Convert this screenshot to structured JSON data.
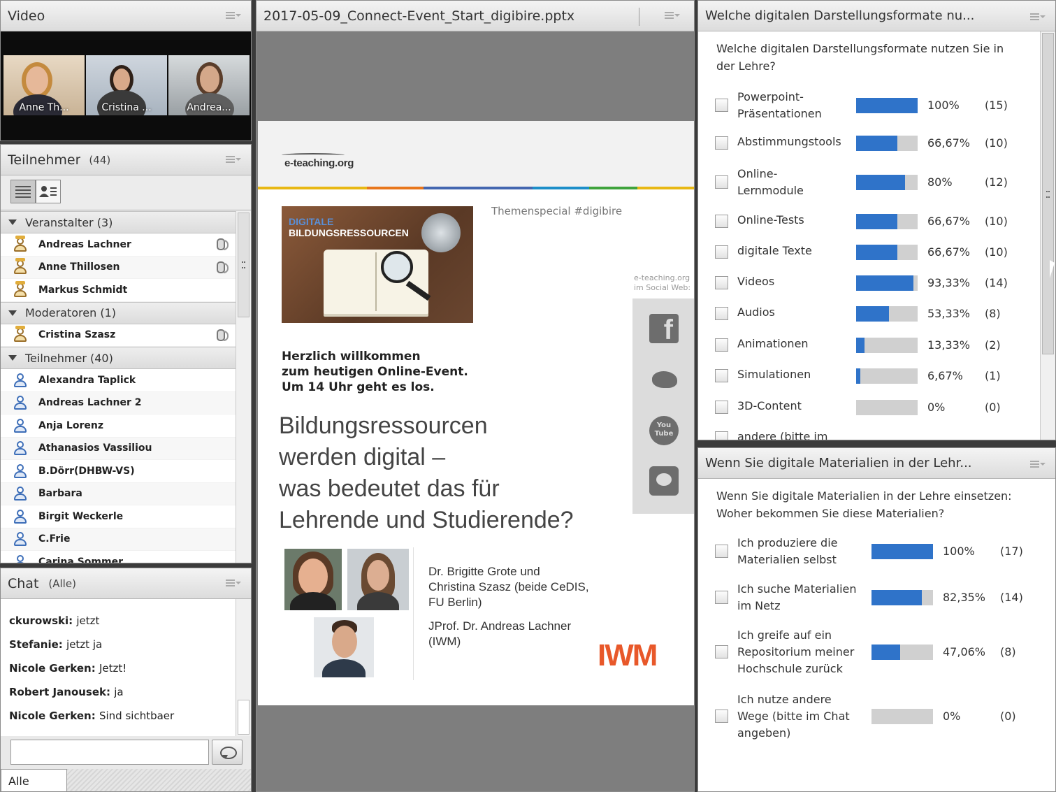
{
  "video": {
    "title": "Video",
    "tiles": [
      {
        "name": "Anne Th..."
      },
      {
        "name": "Cristina ..."
      },
      {
        "name": "Andrea..."
      }
    ]
  },
  "attendees": {
    "title": "Teilnehmer",
    "count": "(44)",
    "groups": [
      {
        "label": "Veranstalter (3)",
        "people": [
          {
            "name": "Andreas Lachner",
            "role": "host",
            "mic": true
          },
          {
            "name": "Anne Thillosen",
            "role": "host",
            "mic": true
          },
          {
            "name": "Markus Schmidt",
            "role": "host",
            "mic": false
          }
        ]
      },
      {
        "label": "Moderatoren (1)",
        "people": [
          {
            "name": "Cristina Szasz",
            "role": "host",
            "mic": true
          }
        ]
      },
      {
        "label": "Teilnehmer (40)",
        "people": [
          {
            "name": "Alexandra Taplick"
          },
          {
            "name": "Andreas Lachner 2"
          },
          {
            "name": "Anja Lorenz"
          },
          {
            "name": "Athanasios Vassiliou"
          },
          {
            "name": "B.Dörr(DHBW-VS)"
          },
          {
            "name": "Barbara"
          },
          {
            "name": "Birgit Weckerle"
          },
          {
            "name": "C.Frie"
          },
          {
            "name": "Carina Sommer"
          }
        ]
      }
    ]
  },
  "chat": {
    "title": "Chat",
    "scope": "(Alle)",
    "messages": [
      {
        "user": "ckurowski",
        "text": "jetzt"
      },
      {
        "user": "Stefanie",
        "text": "jetzt ja"
      },
      {
        "user": "Nicole Gerken",
        "text": "Jetzt!"
      },
      {
        "user": "Robert Janousek",
        "text": "ja"
      },
      {
        "user": "Nicole Gerken",
        "text": "Sind sichtbaer"
      }
    ],
    "input_value": "",
    "tab_label": "Alle"
  },
  "share": {
    "title": "2017-05-09_Connect-Event_Start_digibire.pptx",
    "slide": {
      "logo": "e-teaching.org",
      "thumb_line1": "DIGITALE",
      "thumb_line2": "BILDUNGSRESSOURCEN",
      "themen": "Themenspecial #digibire",
      "social_label_1": "e-teaching.org",
      "social_label_2": "im Social Web:",
      "welcome_1": "Herzlich willkommen",
      "welcome_2": "zum heutigen Online-Event.",
      "welcome_3": "Um 14 Uhr geht es los.",
      "headline_1": "Bildungsressourcen",
      "headline_2": "werden digital –",
      "headline_3": "was bedeutet das für",
      "headline_4": "Lehrende und Studierende?",
      "speaker_1a": "Dr. Brigitte Grote und",
      "speaker_1b": "Christina Szasz (beide CeDIS,",
      "speaker_1c": "FU Berlin)",
      "speaker_2a": "JProf. Dr. Andreas Lachner",
      "speaker_2b": "(IWM)",
      "iwm": "IWM"
    }
  },
  "poll1": {
    "title": "Welche digitalen Darstellungsformate nu...",
    "question": "Welche digitalen Darstellungsformate nutzen Sie in der Lehre?",
    "options": [
      {
        "label": "Powerpoint-\nPräsentationen",
        "value": 100,
        "pct": "100%",
        "count": "(15)"
      },
      {
        "label": "Abstimmungstools",
        "value": 66.67,
        "pct": "66,67%",
        "count": "(10)"
      },
      {
        "label": "Online-\nLernmodule",
        "value": 80,
        "pct": "80%",
        "count": "(12)"
      },
      {
        "label": "Online-Tests",
        "value": 66.67,
        "pct": "66,67%",
        "count": "(10)"
      },
      {
        "label": "digitale Texte",
        "value": 66.67,
        "pct": "66,67%",
        "count": "(10)"
      },
      {
        "label": "Videos",
        "value": 93.33,
        "pct": "93,33%",
        "count": "(14)"
      },
      {
        "label": "Audios",
        "value": 53.33,
        "pct": "53,33%",
        "count": "(8)"
      },
      {
        "label": "Animationen",
        "value": 13.33,
        "pct": "13,33%",
        "count": "(2)"
      },
      {
        "label": "Simulationen",
        "value": 6.67,
        "pct": "6,67%",
        "count": "(1)"
      },
      {
        "label": "3D-Content",
        "value": 0,
        "pct": "0%",
        "count": "(0)"
      },
      {
        "label": "andere (bitte im",
        "value": null,
        "pct": "",
        "count": ""
      }
    ]
  },
  "poll2": {
    "title": "Wenn Sie digitale Materialien in der Lehr...",
    "question": "Wenn Sie digitale Materialien in der Lehre einsetzen: Woher bekommen Sie diese Materialien?",
    "options": [
      {
        "label": "Ich produziere die\nMaterialien selbst",
        "value": 100,
        "pct": "100%",
        "count": "(17)"
      },
      {
        "label": "Ich suche Materialien\nim Netz",
        "value": 82.35,
        "pct": "82,35%",
        "count": "(14)"
      },
      {
        "label": "Ich greife auf ein\nRepositorium meiner\nHochschule zurück",
        "value": 47.06,
        "pct": "47,06%",
        "count": "(8)"
      },
      {
        "label": "Ich nutze andere\nWege (bitte im Chat\nangeben)",
        "value": 0,
        "pct": "0%",
        "count": "(0)"
      }
    ]
  },
  "colors": {
    "poll_fill": "#2f73c9",
    "poll_track": "#d0d0d0",
    "iwm": "#e8582a"
  }
}
